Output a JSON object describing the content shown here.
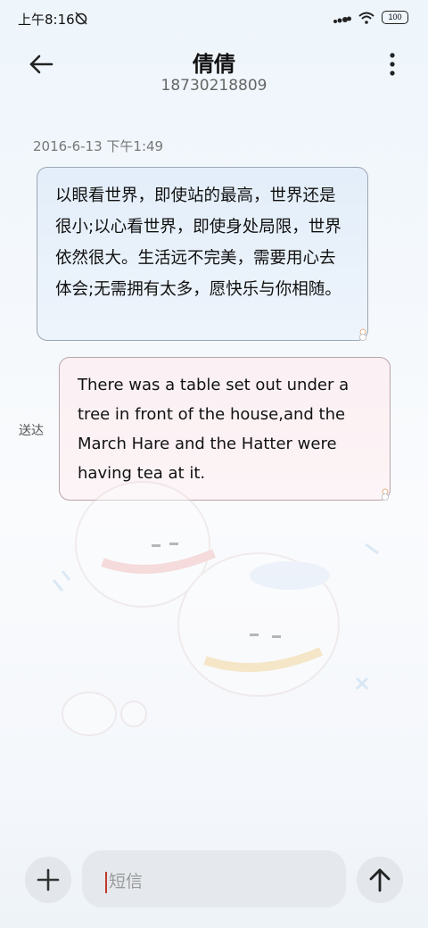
{
  "status_bar": {
    "time": "上午8:16",
    "battery": "100",
    "icons": [
      "alarm-off-icon",
      "signal-icon",
      "wifi-icon",
      "battery-icon"
    ]
  },
  "header": {
    "contact_name": "倩倩",
    "phone_number": "18730218809",
    "icons": [
      "back-arrow-icon",
      "more-vertical-icon"
    ]
  },
  "conversation": {
    "timestamp": "2016-6-13 下午1:49",
    "messages": [
      {
        "direction": "incoming",
        "text": "以眼看世界，即使站的最高，世界还是很小;以心看世界，即使身处局限，世界依然很大。生活远不完美，需要用心去体会;无需拥有太多，愿快乐与你相随。"
      },
      {
        "direction": "outgoing",
        "text": "There was a table set out under a tree in front of the house,and the March Hare and the Hatter were having tea at it.",
        "status": "送达"
      }
    ]
  },
  "composer": {
    "placeholder": "短信",
    "icons": [
      "plus-icon",
      "send-arrow-up-icon"
    ]
  }
}
